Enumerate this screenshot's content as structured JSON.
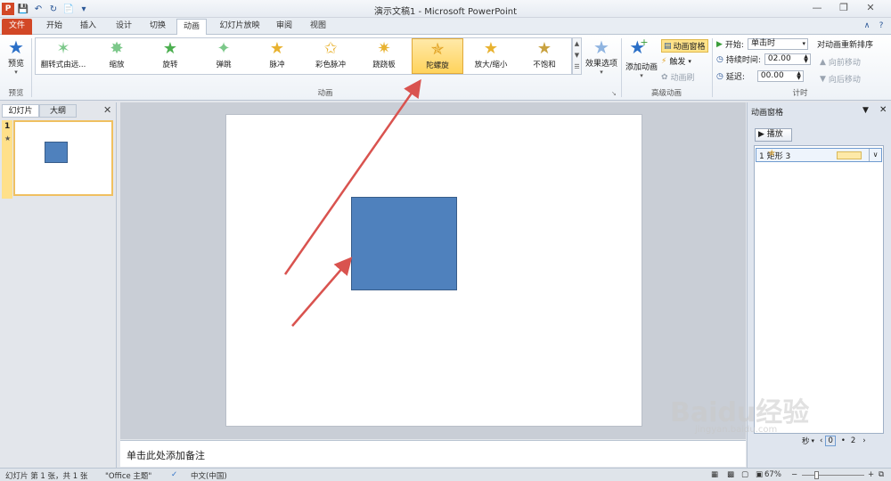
{
  "window": {
    "title": "演示文稿1 - Microsoft PowerPoint"
  },
  "tabs": [
    "文件",
    "开始",
    "插入",
    "设计",
    "切换",
    "动画",
    "幻灯片放映",
    "审阅",
    "视图"
  ],
  "ribbon": {
    "preview_label": "预览",
    "preview_group": "预览",
    "animations": [
      "翻转式由远...",
      "缩放",
      "旋转",
      "弹跳",
      "脉冲",
      "彩色脉冲",
      "跷跷板",
      "陀螺旋",
      "放大/缩小",
      "不饱和"
    ],
    "selected_animation": "陀螺旋",
    "effect_options": "效果选项",
    "animation_group": "动画",
    "add_animation": "添加动画",
    "animation_pane": "动画窗格",
    "trigger": "触发",
    "animation_painter": "动画刷",
    "advanced_group": "高级动画",
    "start_label": "开始:",
    "start_value": "单击时",
    "duration_label": "持续时间:",
    "duration_value": "02.00",
    "delay_label": "延迟:",
    "delay_value": "00.00",
    "reorder_label": "对动画重新排序",
    "move_earlier": "向前移动",
    "move_later": "向后移动",
    "timing_group": "计时"
  },
  "left_pane": {
    "tab_slides": "幻灯片",
    "tab_outline": "大纲",
    "slide_number": "1"
  },
  "notes_placeholder": "单击此处添加备注",
  "anim_pane": {
    "title": "动画窗格",
    "play_button": "播放",
    "item_label": "1  矩形 3",
    "seconds_label": "秒",
    "timeline_start": "0",
    "timeline_end": "2"
  },
  "status": {
    "slide_info": "幻灯片 第 1 张，共 1 张",
    "theme": "\"Office 主题\"",
    "language": "中文(中国)",
    "zoom": "67%"
  },
  "watermark": {
    "brand": "Baidu经验",
    "url": "jingyan.baidu.com"
  },
  "colors": {
    "shape_fill": "#4f81bd",
    "file_tab": "#d24726",
    "selected_gallery": "#ffd35c",
    "arrow": "#d9534f"
  }
}
